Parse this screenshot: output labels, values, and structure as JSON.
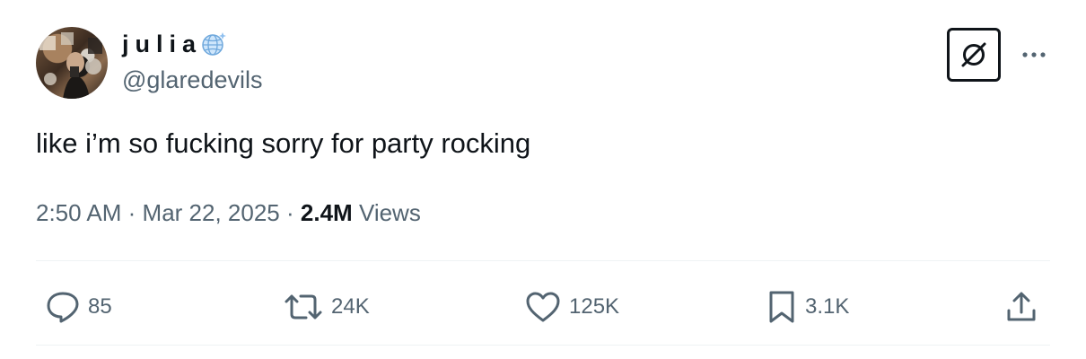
{
  "tweet": {
    "author": {
      "display_name": "julia",
      "handle": "@glaredevils",
      "badge_icon": "globe-emoji-icon"
    },
    "text": "like i’m so fucking sorry for party rocking",
    "time": "2:50 AM",
    "separator": "·",
    "date": "Mar 22, 2025",
    "views_count": "2.4M",
    "views_label": "Views"
  },
  "header_actions": {
    "grok_icon": "grok-icon",
    "more_icon": "more-icon"
  },
  "actions": {
    "replies": {
      "icon": "reply-icon",
      "count": "85"
    },
    "retweets": {
      "icon": "retweet-icon",
      "count": "24K"
    },
    "likes": {
      "icon": "like-icon",
      "count": "125K"
    },
    "bookmarks": {
      "icon": "bookmark-icon",
      "count": "3.1K"
    },
    "share": {
      "icon": "share-icon"
    }
  },
  "colors": {
    "text_primary": "#0f1419",
    "text_secondary": "#536471",
    "divider": "#eff3f4"
  }
}
